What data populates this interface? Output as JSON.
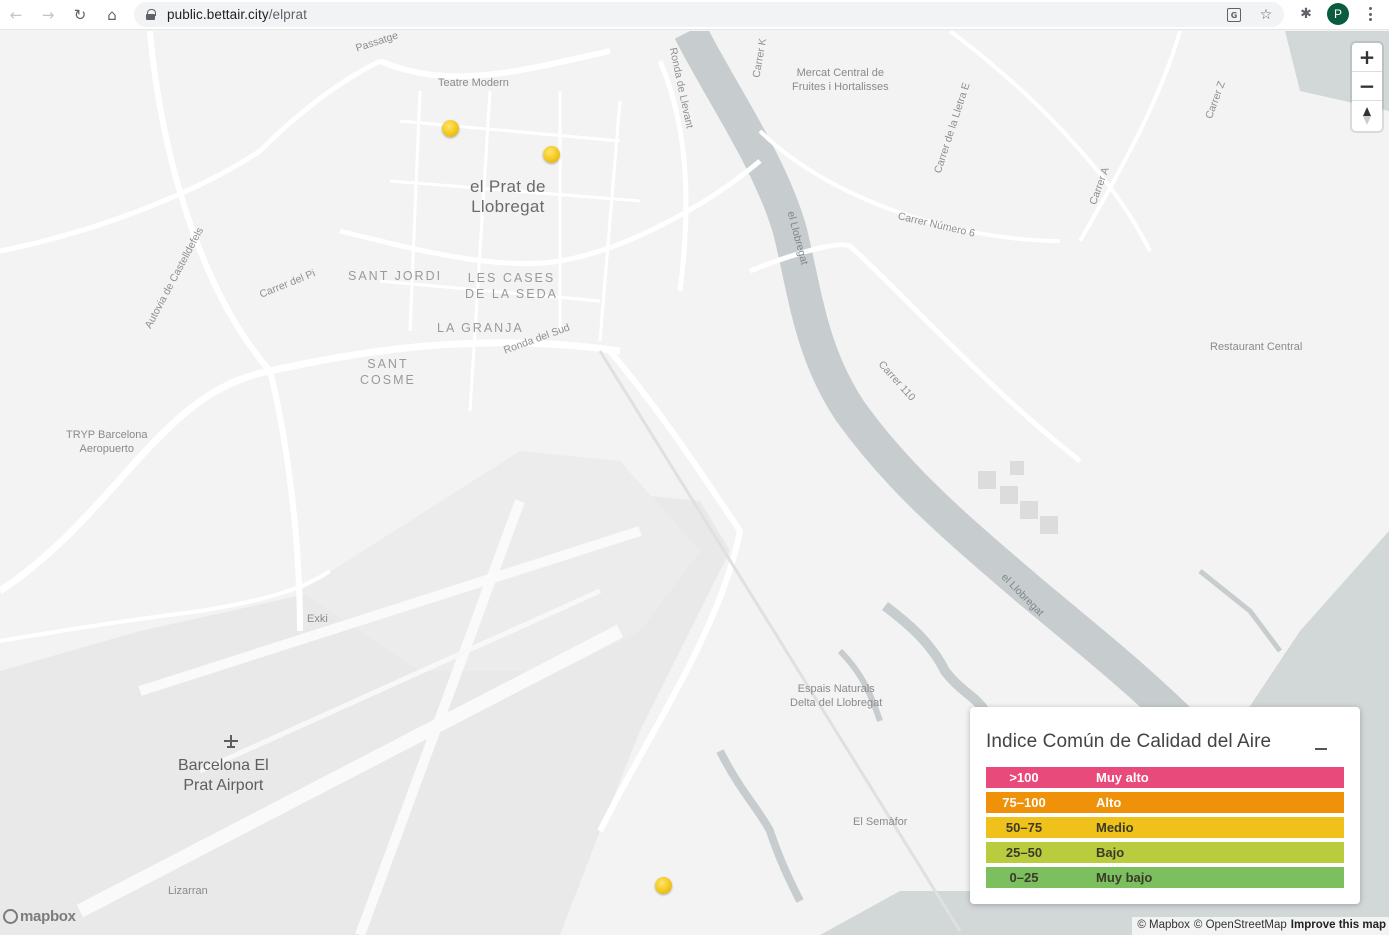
{
  "browser": {
    "url_host": "public.bettair.city",
    "url_path": "/elprat",
    "back_icon": "back-arrow-icon",
    "forward_icon": "forward-arrow-icon",
    "reload_icon": "reload-icon",
    "home_icon": "home-icon",
    "profile_initial": "P"
  },
  "map": {
    "labels": {
      "teatre_modern": "Teatre Modern",
      "mercat_central": "Mercat Central de\nFruites i Hortalisses",
      "el_prat": "el Prat de\nLlobregat",
      "sant_jordi": "SANT JORDI",
      "les_cases": "LES CASES\nDE LA SEDA",
      "la_granja": "LA GRANJA",
      "sant_cosme": "SANT\nCOSME",
      "tryp": "TRYP Barcelona\nAeropuerto",
      "restaurant_central": "Restaurant Central",
      "exki": "Exki",
      "airport": "Barcelona El\nPrat Airport",
      "espais_naturals": "Espais Naturals\nDelta del Llobregat",
      "el_semafor": "El Semàfor",
      "lizarran": "Lizarran",
      "passatge": "Passatge",
      "ronda_llevant": "Ronda de Llevant",
      "carrer_k": "Carrer K",
      "carrer_lletra_e": "Carrer de la Lletra E",
      "carrer_z": "Carrer Z",
      "carrer_a": "Carrer A",
      "carrer_numero_6": "Carrer Número 6",
      "el_llobregat_1": "el Llobregat",
      "el_llobregat_2": "el Llobregat",
      "carrer_110": "Carrer 110",
      "carrer_del_pi": "Carrer del Pi",
      "autovia": "Autovia de Castelldefels",
      "ronda_sud": "Ronda del Sud"
    },
    "controls": {
      "zoom_in": "+",
      "zoom_out": "−"
    },
    "mapbox_logo": "mapbox",
    "attribution": {
      "mapbox": "© Mapbox",
      "osm": "© OpenStreetMap",
      "improve": "Improve this map"
    }
  },
  "legend": {
    "title": "Indice Común de Calidad del Aire",
    "rows": [
      {
        "range": ">100",
        "label": "Muy alto",
        "color": "#e84a7c"
      },
      {
        "range": "75–100",
        "label": "Alto",
        "color": "#f0910a"
      },
      {
        "range": "50–75",
        "label": "Medio",
        "color": "#efc11a"
      },
      {
        "range": "25–50",
        "label": "Bajo",
        "color": "#b8cc3e"
      },
      {
        "range": "0–25",
        "label": "Muy bajo",
        "color": "#7cbf5e"
      }
    ]
  }
}
